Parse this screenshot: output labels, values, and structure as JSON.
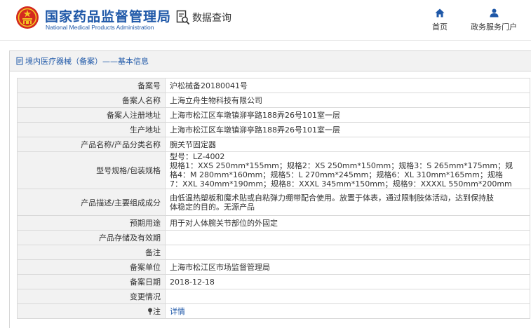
{
  "header": {
    "org_name_cn": "国家药品监督管理局",
    "org_name_en": "National Medical Products Administration",
    "data_query": "数据查询",
    "nav": [
      {
        "label": "首页",
        "icon": "home-icon"
      },
      {
        "label": "政务服务门户",
        "icon": "user-icon"
      }
    ]
  },
  "breadcrumb": "境内医疗器械（备案）——基本信息",
  "colors": {
    "brand": "#1f58a8",
    "label_bg": "#f2f2f2",
    "border": "#d9d9d9"
  },
  "record": {
    "rows": [
      {
        "label": "备案号",
        "value": "沪松械备20180041号"
      },
      {
        "label": "备案人名称",
        "value": "上海立舟生物科技有限公司"
      },
      {
        "label": "备案人注册地址",
        "value": "上海市松江区车墩镇泖亭路188弄26号101室一层"
      },
      {
        "label": "生产地址",
        "value": "上海市松江区车墩镇泖亭路188弄26号101室一层"
      },
      {
        "label": "产品名称/产品分类名称",
        "value": "腕关节固定器"
      },
      {
        "label": "型号规格/包装规格",
        "value_lines": [
          "型号：LZ-4002",
          "规格1：XXS 250mm*155mm；规格2：XS 250mm*150mm；规格3：S 265mm*175mm；规",
          "格4：M 280mm*160mm；规格5：L 270mm*245mm；规格6：XL 310mm*165mm；规格",
          "7：XXL 340mm*190mm；规格8：XXXL 345mm*150mm；规格9：XXXXL 550mm*200mm"
        ]
      },
      {
        "label": "产品描述/主要组成成分",
        "value_lines": [
          "由低温热塑板和魔术贴或自粘弹力绷带配合使用。放置于体表，通过限制肢体活动，达到保持肢",
          "体稳定的目的。无源产品"
        ]
      },
      {
        "label": "预期用途",
        "value": "用于对人体腕关节部位的外固定"
      },
      {
        "label": "产品存储及有效期",
        "value": ""
      },
      {
        "label": "备注",
        "value": ""
      },
      {
        "label": "备案单位",
        "value": "上海市松江区市场监督管理局"
      },
      {
        "label": "备案日期",
        "value": "2018-12-18"
      },
      {
        "label": "变更情况",
        "value": ""
      },
      {
        "label": "注",
        "icon": "pin-icon",
        "value": "详情"
      }
    ]
  }
}
